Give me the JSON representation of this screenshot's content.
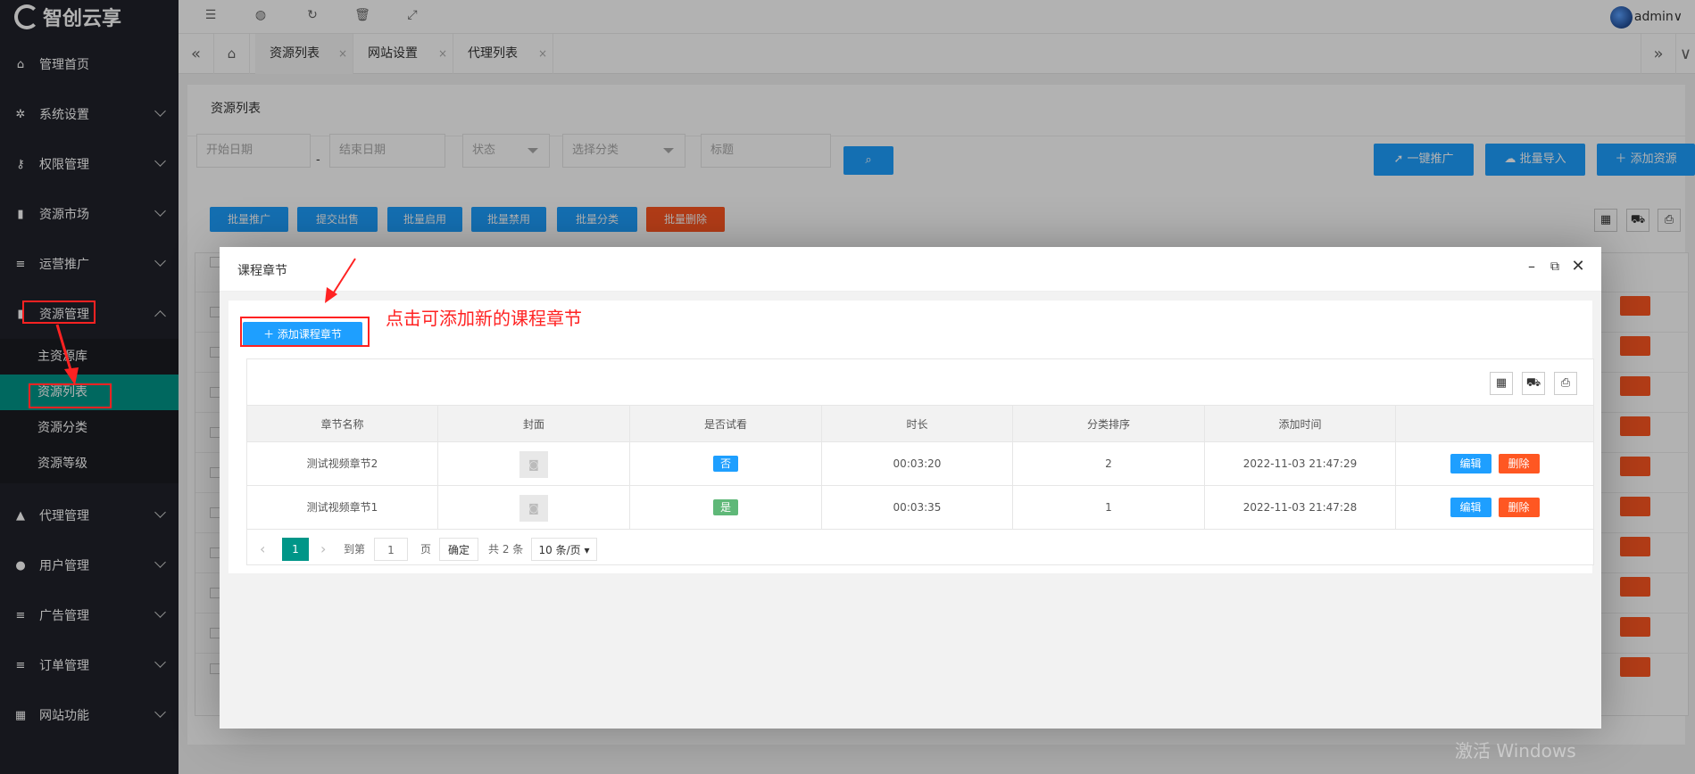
{
  "brand": {
    "logo_text": "智创云享"
  },
  "sidebar": {
    "items": [
      {
        "label": "管理首页",
        "icon": "home-icon",
        "glyph": "⌂"
      },
      {
        "label": "系统设置",
        "icon": "gear-icon",
        "glyph": "✲"
      },
      {
        "label": "权限管理",
        "icon": "key-icon",
        "glyph": "⚷"
      },
      {
        "label": "资源市场",
        "icon": "book-icon",
        "glyph": "▮"
      },
      {
        "label": "运营推广",
        "icon": "list-icon",
        "glyph": "≡"
      },
      {
        "label": "资源管理",
        "icon": "bookmark-icon",
        "glyph": "▮"
      },
      {
        "label": "代理管理",
        "icon": "lock-icon",
        "glyph": "▲"
      },
      {
        "label": "用户管理",
        "icon": "user-icon",
        "glyph": "●"
      },
      {
        "label": "广告管理",
        "icon": "list-icon",
        "glyph": "≡"
      },
      {
        "label": "订单管理",
        "icon": "list-icon",
        "glyph": "≡"
      },
      {
        "label": "网站功能",
        "icon": "grid-icon",
        "glyph": "▦"
      }
    ],
    "submenu": [
      "主资源库",
      "资源列表",
      "资源分类",
      "资源等级"
    ]
  },
  "topbar": {
    "user": "admin",
    "chevron": "∨"
  },
  "tabs": {
    "left_nav": "«",
    "home_icon": "⌂",
    "items": [
      "资源列表",
      "网站设置",
      "代理列表"
    ],
    "close": "×",
    "right_nav": "»"
  },
  "page": {
    "card_tab": "资源列表",
    "filters": {
      "start_date": "开始日期",
      "dash": "-",
      "end_date": "结束日期",
      "status": "状态",
      "category": "选择分类",
      "title": "标题"
    },
    "top_buttons": [
      "一键推广",
      "批量导入",
      "添加资源"
    ],
    "batch_buttons": [
      "批量推广",
      "提交出售",
      "批量启用",
      "批量禁用",
      "批量分类",
      "批量删除"
    ]
  },
  "watermark": "激活 Windows",
  "modal": {
    "title": "课程章节",
    "add_button": "添加课程章节",
    "annotation": "点击可添加新的课程章节",
    "columns": [
      "章节名称",
      "封面",
      "是否试看",
      "时长",
      "分类排序",
      "添加时间",
      ""
    ],
    "rows": [
      {
        "name": "测试视频章节2",
        "trial": "否",
        "duration": "00:03:20",
        "sort": "2",
        "added": "2022-11-03 21:47:29",
        "edit": "编辑",
        "delete": "删除"
      },
      {
        "name": "测试视频章节1",
        "trial": "是",
        "duration": "00:03:35",
        "sort": "1",
        "added": "2022-11-03 21:47:28",
        "edit": "编辑",
        "delete": "删除"
      }
    ],
    "pager": {
      "prev": "‹",
      "current": "1",
      "next": "›",
      "goto_label": "到第",
      "goto_value": "1",
      "page_label": "页",
      "confirm": "确定",
      "total": "共 2 条",
      "page_size": "10 条/页"
    },
    "colors": {
      "accent": "#1e9fff",
      "active": "#009688",
      "danger": "#ff5722",
      "success": "#5fb878",
      "annotation": "#ff2222"
    }
  }
}
